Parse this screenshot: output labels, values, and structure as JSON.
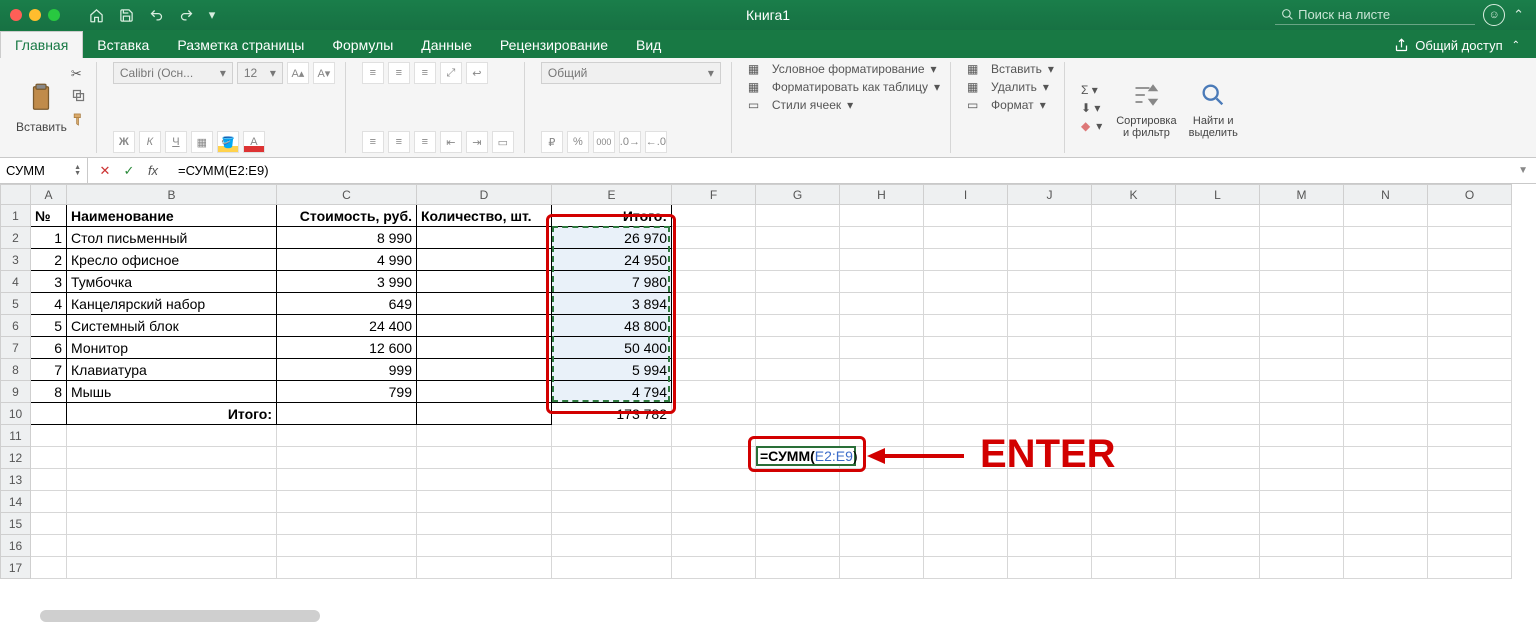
{
  "window": {
    "title": "Книга1",
    "search_placeholder": "Поиск на листе"
  },
  "tabs": {
    "home": "Главная",
    "insert": "Вставка",
    "layout": "Разметка страницы",
    "formulas": "Формулы",
    "data": "Данные",
    "review": "Рецензирование",
    "view": "Вид",
    "share": "Общий доступ"
  },
  "ribbon": {
    "paste": "Вставить",
    "font_name": "Calibri (Осн...",
    "font_size": "12",
    "number_format": "Общий",
    "cond_fmt": "Условное форматирование",
    "fmt_table": "Форматировать как таблицу",
    "cell_styles": "Стили ячеек",
    "insert": "Вставить",
    "delete": "Удалить",
    "format": "Формат",
    "sort": "Сортировка\nи фильтр",
    "find": "Найти и\nвыделить",
    "bold": "Ж",
    "italic": "К",
    "underline": "Ч",
    "percent": "%",
    "thousand": "000"
  },
  "formula_bar": {
    "name": "СУММ",
    "formula": "=СУММ(E2:E9)"
  },
  "columns": [
    "A",
    "B",
    "C",
    "D",
    "E",
    "F",
    "G",
    "H",
    "I",
    "J",
    "K",
    "L",
    "M",
    "N",
    "O"
  ],
  "headers": {
    "num": "№",
    "name": "Наименование",
    "cost": "Стоимость, руб.",
    "qty": "Количество, шт.",
    "total": "Итого:"
  },
  "rows": [
    {
      "n": "1",
      "name": "Стол письменный",
      "cost": "8 990",
      "total": "26 970"
    },
    {
      "n": "2",
      "name": "Кресло офисное",
      "cost": "4 990",
      "total": "24 950"
    },
    {
      "n": "3",
      "name": "Тумбочка",
      "cost": "3 990",
      "total": "7 980"
    },
    {
      "n": "4",
      "name": "Канцелярский набор",
      "cost": "649",
      "total": "3 894"
    },
    {
      "n": "5",
      "name": "Системный блок",
      "cost": "24 400",
      "total": "48 800"
    },
    {
      "n": "6",
      "name": "Монитор",
      "cost": "12 600",
      "total": "50 400"
    },
    {
      "n": "7",
      "name": "Клавиатура",
      "cost": "999",
      "total": "5 994"
    },
    {
      "n": "8",
      "name": "Мышь",
      "cost": "799",
      "total": "4 794"
    }
  ],
  "totals_row": {
    "label": "Итого:",
    "value": "173 782"
  },
  "edit_cell": {
    "prefix": "=СУММ(",
    "range": "E2:E9",
    "suffix": ")"
  },
  "annotation": {
    "enter": "ENTER"
  }
}
